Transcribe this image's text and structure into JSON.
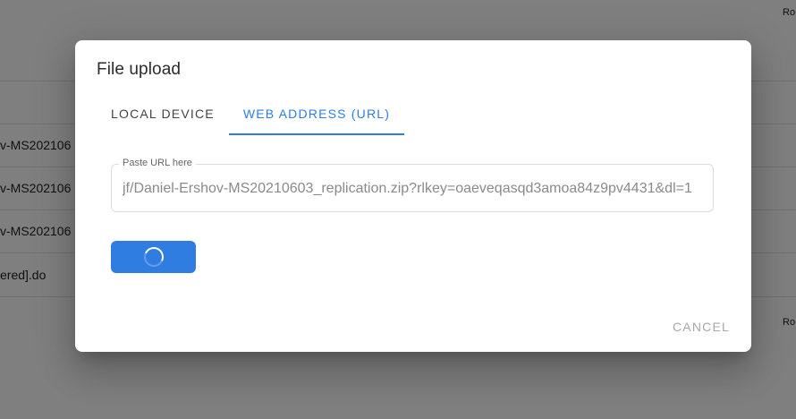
{
  "background": {
    "rows": [
      {
        "text": "v-MS202106"
      },
      {
        "text": "v-MS202106"
      },
      {
        "text": "v-MS202106"
      },
      {
        "text": "ered].do"
      }
    ],
    "right_labels": [
      "Ro",
      "Ro"
    ]
  },
  "dialog": {
    "title": "File upload",
    "tabs": [
      {
        "label": "LOCAL DEVICE",
        "active": false
      },
      {
        "label": "WEB ADDRESS (URL)",
        "active": true
      }
    ],
    "url_field": {
      "label": "Paste URL here",
      "value": "jf/Daniel-Ershov-MS20210603_replication.zip?rlkey=oaeveqasqd3amoa84z9pv4431&dl=1"
    },
    "submit_button": {
      "state": "loading",
      "icon": "spinner-icon"
    },
    "cancel_label": "CANCEL"
  },
  "colors": {
    "accent": "#2f7de1",
    "overlay": "rgba(0,0,0,0.5)"
  }
}
